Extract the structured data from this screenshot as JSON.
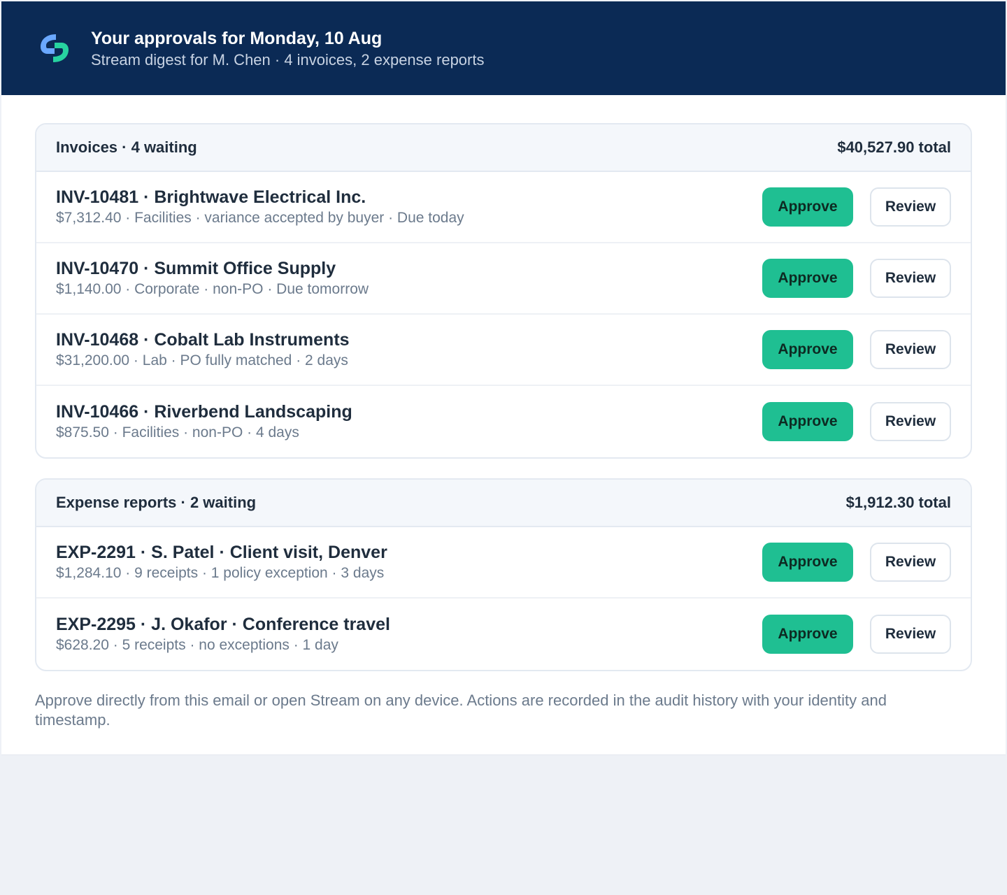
{
  "header": {
    "title": "Your approvals for Monday, 10 Aug",
    "subtitle": "Stream digest for M. Chen · 4 invoices, 2 expense reports",
    "logo_icon": "stream-logo-icon",
    "background_color": "#0b2a55"
  },
  "buttons": {
    "approve_label": "Approve",
    "review_label": "Review",
    "approve_color": "#1fbf92"
  },
  "invoices": {
    "title": "Invoices · 4 waiting",
    "total": "$40,527.90 total",
    "items": [
      {
        "title": "INV-10481 · Brightwave Electrical Inc.",
        "meta": "$7,312.40 · Facilities · variance accepted by buyer · Due today"
      },
      {
        "title": "INV-10470 · Summit Office Supply",
        "meta": "$1,140.00 · Corporate · non-PO · Due tomorrow"
      },
      {
        "title": "INV-10468 · Cobalt Lab Instruments",
        "meta": "$31,200.00 · Lab · PO fully matched · 2 days"
      },
      {
        "title": "INV-10466 · Riverbend Landscaping",
        "meta": "$875.50 · Facilities · non-PO · 4 days"
      }
    ]
  },
  "expenses": {
    "title": "Expense reports · 2 waiting",
    "total": "$1,912.30 total",
    "items": [
      {
        "title": "EXP-2291 · S. Patel · Client visit, Denver",
        "meta": "$1,284.10 · 9 receipts · 1 policy exception · 3 days"
      },
      {
        "title": "EXP-2295 · J. Okafor · Conference travel",
        "meta": "$628.20 · 5 receipts · no exceptions · 1 day"
      }
    ]
  },
  "footer": {
    "note": "Approve directly from this email or open Stream on any device. Actions are recorded in the audit history with your identity and timestamp."
  }
}
